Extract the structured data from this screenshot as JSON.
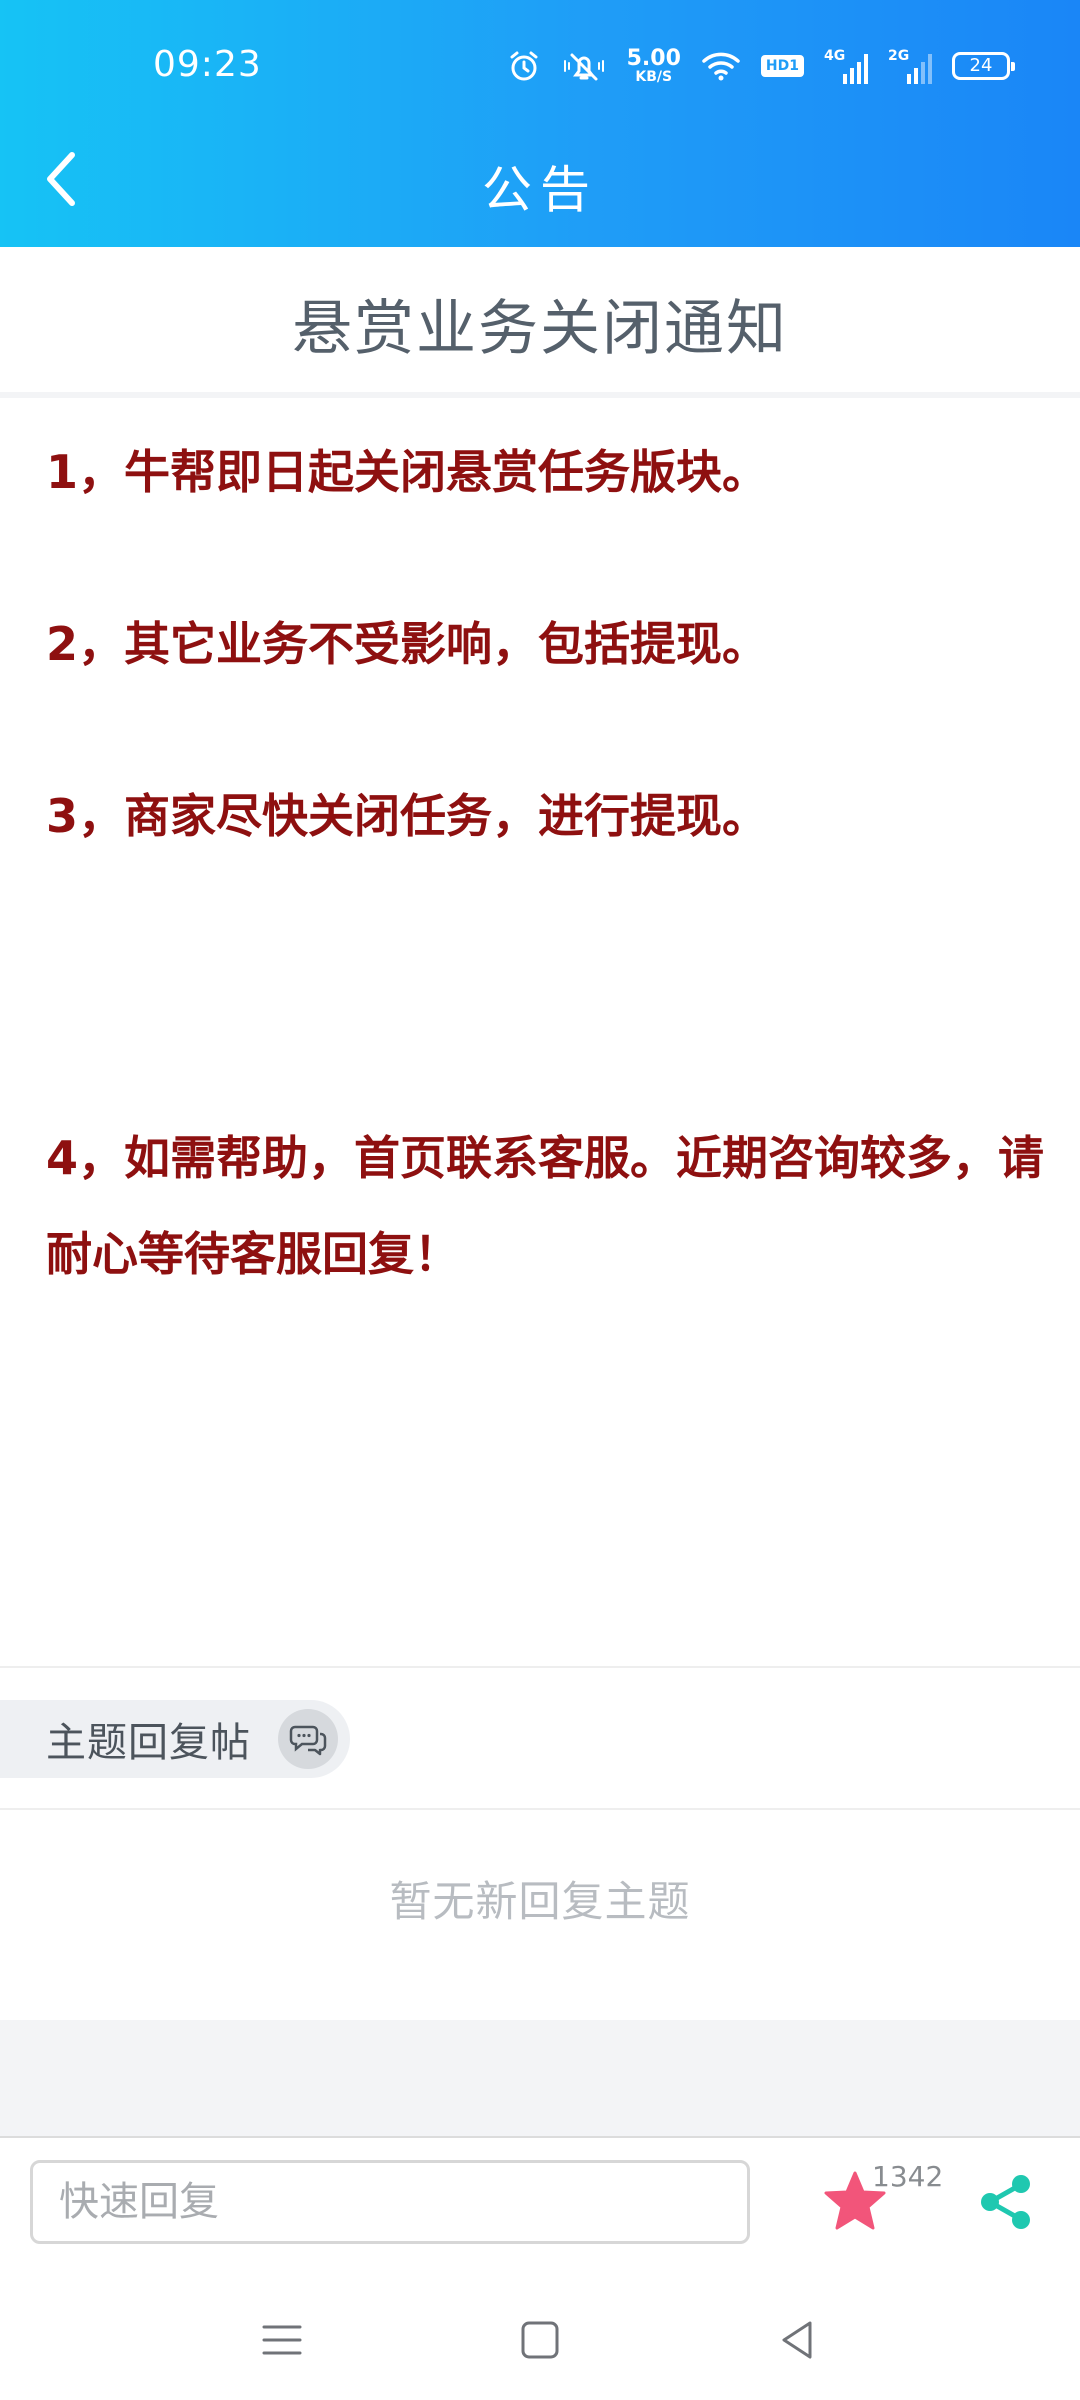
{
  "status_bar": {
    "time": "09:23",
    "net_speed_value": "5.00",
    "net_speed_unit": "KB/S",
    "hd_label": "HD1",
    "sim1_label": "4G",
    "sim2_label": "2G",
    "battery": "24",
    "icons": [
      "alarm-icon",
      "mute-icon",
      "wifi-icon",
      "signal-icon",
      "battery-icon"
    ]
  },
  "header": {
    "title": "公告",
    "back_icon": "chevron-left-icon",
    "gradient_start": "#16c3f5",
    "gradient_end": "#1a86f7"
  },
  "article": {
    "title": "悬赏业务关闭通知",
    "paragraphs": [
      "1，牛帮即日起关闭悬赏任务版块。",
      "2，其它业务不受影响，包括提现。",
      "3，商家尽快关闭任务，进行提现。",
      "4，如需帮助，首页联系客服。近期咨询较多，请耐心等待客服回复！"
    ],
    "text_color": "#8e1010"
  },
  "replies": {
    "section_label": "主题回复帖",
    "empty_text": "暂无新回复主题"
  },
  "bottom_bar": {
    "reply_placeholder": "快速回复",
    "favorite_count": "1342",
    "favorite_color": "#f2557a",
    "share_color": "#1fc8b0"
  },
  "system_nav": {
    "icons": [
      "menu-icon",
      "home-icon",
      "back-triangle-icon"
    ]
  }
}
